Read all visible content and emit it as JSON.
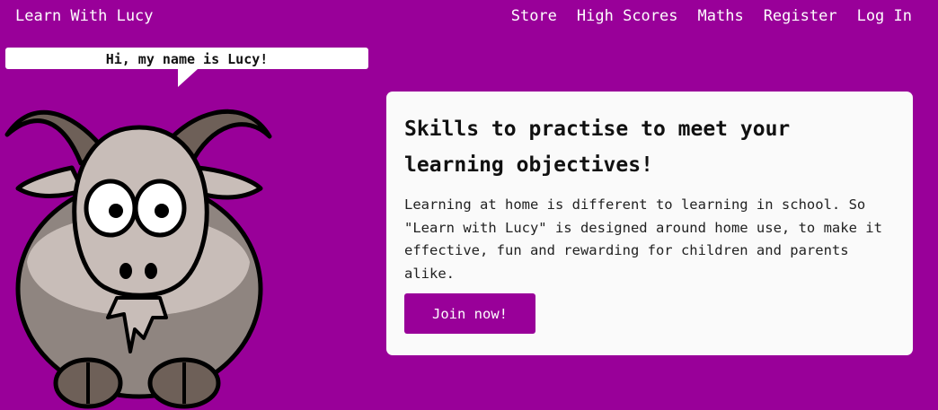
{
  "nav": {
    "brand": "Learn With Lucy",
    "links": [
      "Store",
      "High Scores",
      "Maths",
      "Register",
      "Log In"
    ]
  },
  "mascot": {
    "speech": "Hi, my name is Lucy!"
  },
  "card": {
    "title": "Skills to practise to meet your learning objectives!",
    "body": "Learning at home is different to learning in school. So \"Learn with Lucy\" is designed around home use, to make it effective, fun and rewarding for children and parents alike.",
    "button_label": "Join now!"
  },
  "colors": {
    "brand_purple": "#990099",
    "card_background": "#fafafa"
  },
  "icons": {
    "mascot": "goat-illustration"
  }
}
